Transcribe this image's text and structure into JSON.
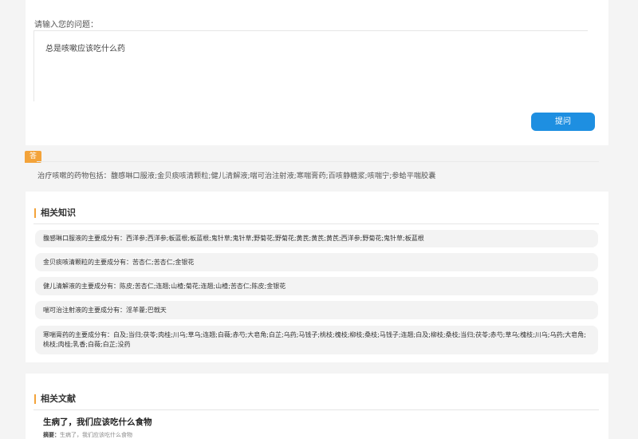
{
  "question": {
    "label": "请输入您的问题：",
    "value": "总是咳嗽应该吃什么药",
    "submit_label": "提问"
  },
  "answer": {
    "badge": "答",
    "text": "治疗咳嗽的药物包括：馥感啉口服液;金贝痰咳清颗粒;健儿清解液;喘可治注射液;寒喘膏药;百咳静糖浆;咳喘宁;参蛤平喘胶囊"
  },
  "knowledge": {
    "title": "相关知识",
    "items": [
      {
        "text": "馥感啉口服液的主要成分有：西洋参;西洋参;板蓝根;板蓝根;鬼针草;鬼针草;野菊花;野菊花;黄芪;黄芪;黄芪;西洋参;野菊花;鬼针草;板蓝根"
      },
      {
        "text": "金贝痰咳清颗粒的主要成分有：苦杏仁;苦杏仁;金银花"
      },
      {
        "text": "健儿清解液的主要成分有：陈皮;苦杏仁;连翘;山楂;菊花;连翘;山楂;苦杏仁;陈皮;金银花"
      },
      {
        "text": "喘可治注射液的主要成分有：淫羊藿;巴戟天"
      },
      {
        "text": "寒喘膏药的主要成分有：白及;当归;茯苓;肉桂;川乌;草乌;连翘;白薇;赤芍;大皂角;白芷;乌药;马钱子;桃枝;槐枝;柳枝;桑枝;马钱子;连翘;白及;柳枝;桑枝;当归;茯苓;赤芍;草乌;槐枝;川乌;乌药;大皂角;桃枝;肉桂;乳香;白薇;白芷;没药"
      }
    ]
  },
  "literature": {
    "title": "相关文献",
    "item_title": "生病了，我们应该吃什么食物",
    "snippet_label": "摘要：",
    "snippet_text": "生病了，我们应该吃什么食物"
  }
}
